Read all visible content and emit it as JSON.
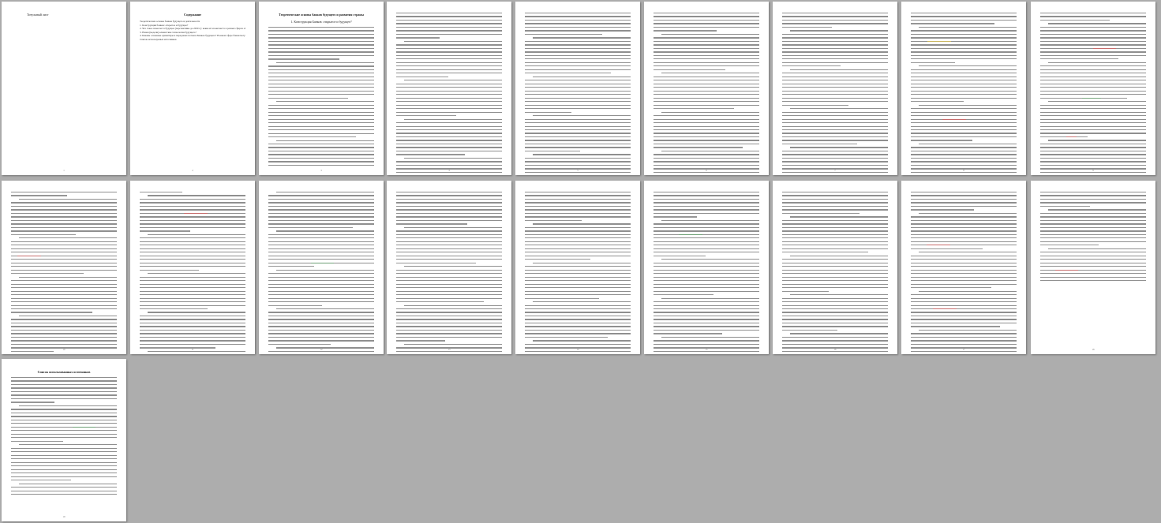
{
  "document": {
    "title_page_text": "Титульный лист",
    "toc_heading": "Содержание",
    "toc_items": [
      "Теоретические основы банков будущего и деятельности",
      "1. Конструкция банков: открытое и будущее?",
      "2. Что такое помогает в будущее (перспективы до 2030 г.): какие ит и контекста в разных сферах образовательности?",
      "3. Новая (модели) клиентские технологии будущего?",
      "4. Каковы основные ориентиры в передовых потоках Банков будущего? В каком сфере банки могут подтолкнуть выход на передовые технологии?",
      "Список используемых источников"
    ],
    "chapter_heading": "Теоретические основы банков будущего и развития страны",
    "chapter_subheading": "1. Конструкция Банков: открытое и будущее?",
    "references_heading": "Список использованных источников",
    "page_numbers": [
      "1",
      "2",
      "3",
      "4",
      "5",
      "6",
      "7",
      "8",
      "9",
      "10",
      "11",
      "12",
      "13",
      "14",
      "15",
      "16",
      "17",
      "18",
      "19"
    ]
  },
  "colors": {
    "workspace": "#adadad",
    "page": "#ffffff",
    "text_line": "#6a6a6a",
    "highlight_red": "#cc2b2b",
    "highlight_green": "#2f8a3c",
    "highlight_yellow": "#d6b21a"
  }
}
